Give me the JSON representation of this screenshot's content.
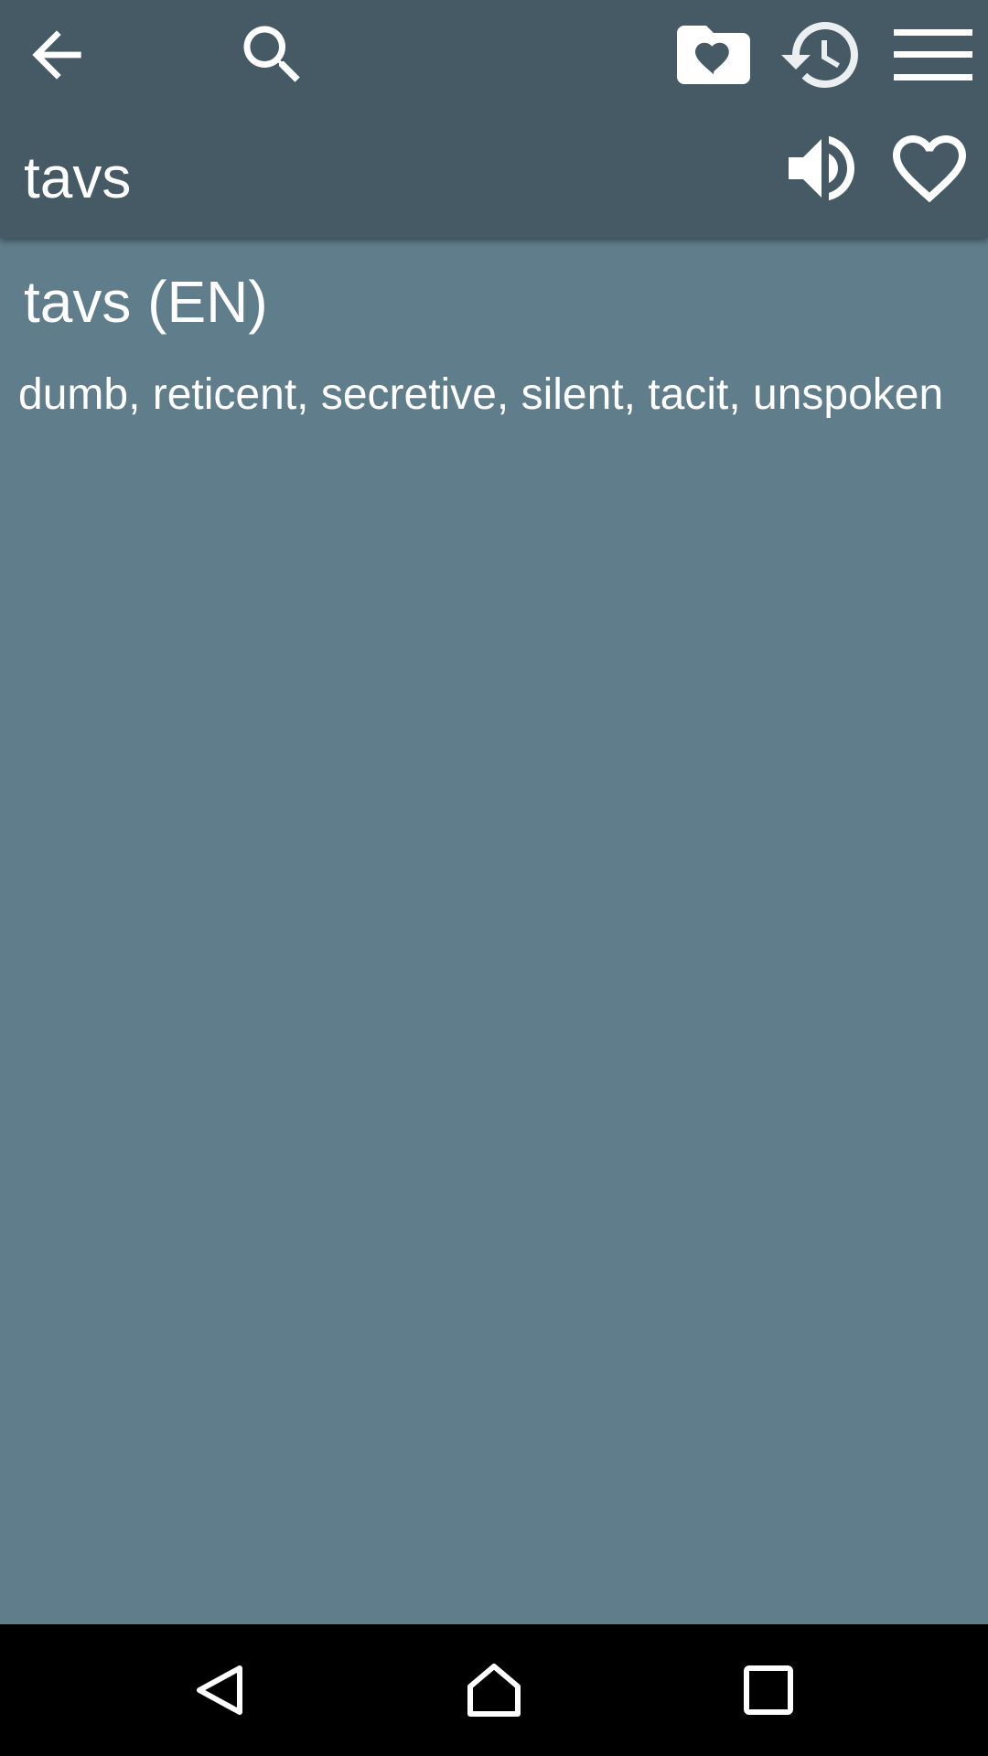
{
  "toolbar": {
    "search_word": "tavs",
    "icons": [
      "arrow-back-icon",
      "search-icon",
      "favorites-folder-icon",
      "history-icon",
      "menu-icon",
      "speaker-icon",
      "heart-outline-icon"
    ]
  },
  "entry": {
    "title": "tavs (EN)",
    "definition": "dumb, reticent, secretive, silent, tacit, unspoken"
  },
  "navbar": {
    "icons": [
      "nav-back-icon",
      "nav-home-icon",
      "nav-recents-icon"
    ]
  },
  "colors": {
    "toolbar_bg": "#455a64",
    "content_bg": "#607d8b",
    "navbar_bg": "#000000",
    "text": "#ffffff"
  }
}
